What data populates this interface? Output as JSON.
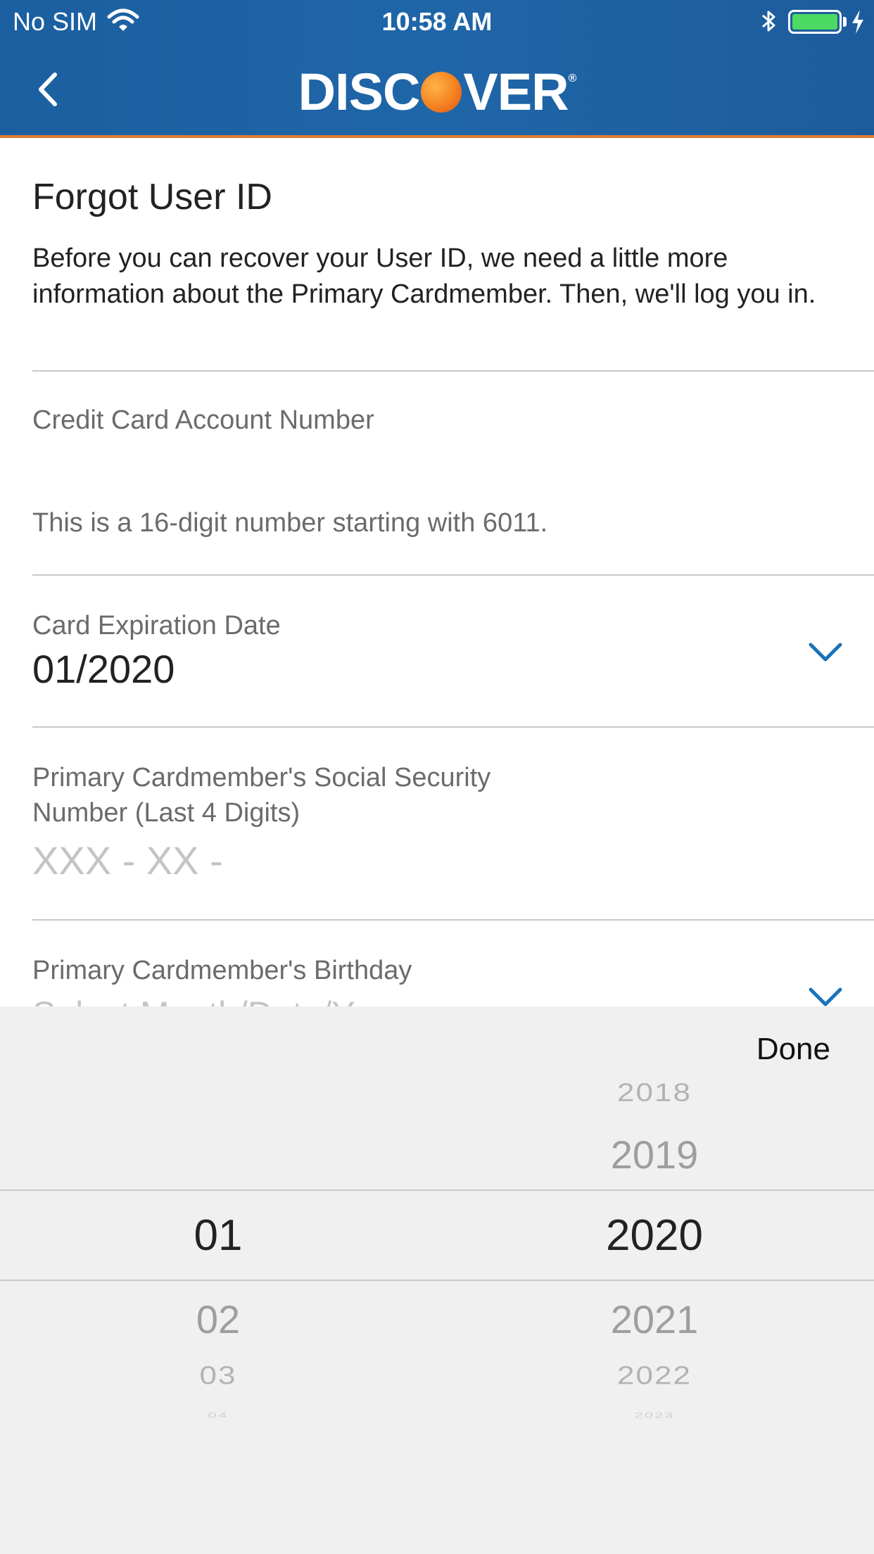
{
  "status_bar": {
    "carrier": "No SIM",
    "time": "10:58 AM"
  },
  "header": {
    "logo_text_left": "DISC",
    "logo_text_right": "VER",
    "logo_mark": "®"
  },
  "form": {
    "title": "Forgot User ID",
    "intro": "Before you can recover your User ID, we need a little more information about the Primary Cardmember. Then, we'll log you in.",
    "account_number_label": "Credit Card Account Number",
    "account_number_hint": "This is a 16-digit number starting with 6011.",
    "expiration_label": "Card Expiration Date",
    "expiration_value": "01/2020",
    "ssn_label_line1": "Primary Cardmember's Social Security",
    "ssn_label_line2": "Number (Last 4 Digits)",
    "ssn_placeholder": "XXX - XX -",
    "birthday_label": "Primary Cardmember's Birthday",
    "birthday_placeholder": "Select Month/Date/Year"
  },
  "picker": {
    "done_label": "Done",
    "months": {
      "selected": "01",
      "after1": "02",
      "after2": "03",
      "after3": "04"
    },
    "years": {
      "before2": "2018",
      "before1": "2019",
      "selected": "2020",
      "after1": "2021",
      "after2": "2022",
      "after3": "2023"
    }
  },
  "colors": {
    "header_blue": "#1f66a8",
    "accent_orange": "#e47a2e",
    "link_blue": "#1a73b8",
    "battery_green": "#4cd964"
  },
  "icons": [
    "wifi-icon",
    "bluetooth-icon",
    "battery-icon",
    "charging-icon",
    "back-chevron-icon",
    "chevron-down-icon"
  ]
}
